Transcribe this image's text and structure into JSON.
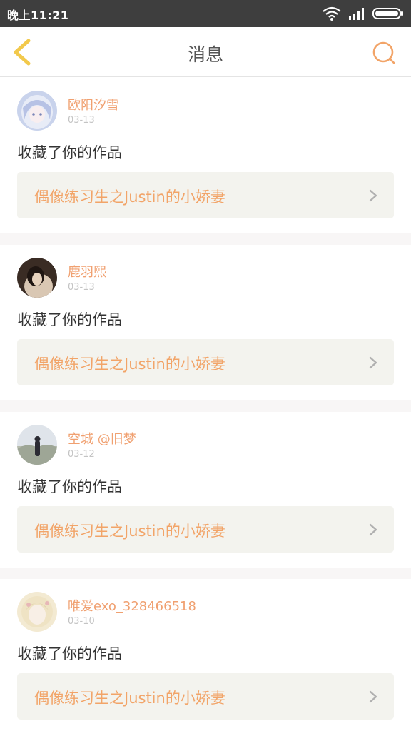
{
  "status_bar": {
    "time": "晚上11:21",
    "icons": [
      "wifi-icon",
      "signal-icon",
      "battery-icon"
    ]
  },
  "header": {
    "title": "消息",
    "back_icon": "chevron-left-icon",
    "search_icon": "search-icon"
  },
  "colors": {
    "accent": "#f2a468",
    "back_icon": "#f2c94c",
    "card_bg": "#f3f3ee",
    "status_bar": "#3e3e3e"
  },
  "messages": [
    {
      "username": "欧阳汐雪",
      "date": "03-13",
      "action": "收藏了你的作品",
      "work_title": "偶像练习生之Justin的小娇妻"
    },
    {
      "username": "鹿羽熙",
      "date": "03-13",
      "action": "收藏了你的作品",
      "work_title": "偶像练习生之Justin的小娇妻"
    },
    {
      "username": "空城 @旧梦",
      "date": "03-12",
      "action": "收藏了你的作品",
      "work_title": "偶像练习生之Justin的小娇妻"
    },
    {
      "username": "唯爱exo_328466518",
      "date": "03-10",
      "action": "收藏了你的作品",
      "work_title": "偶像练习生之Justin的小娇妻"
    }
  ]
}
